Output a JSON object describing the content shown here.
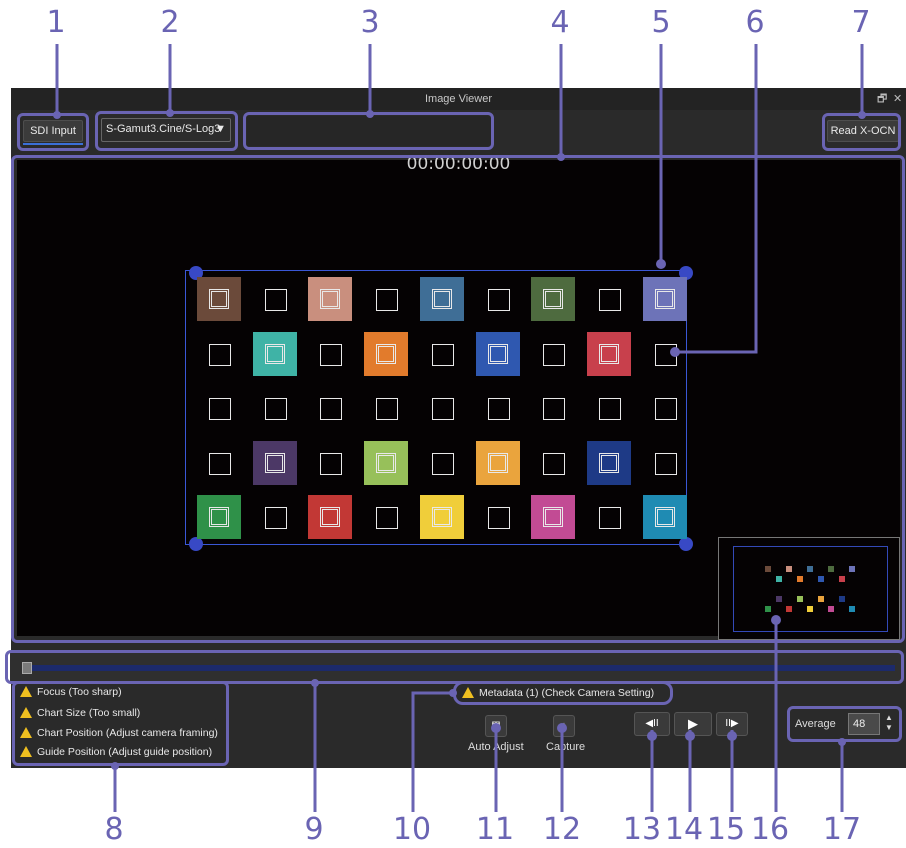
{
  "callouts": [
    "1",
    "2",
    "3",
    "4",
    "5",
    "6",
    "7",
    "8",
    "9",
    "10",
    "11",
    "12",
    "13",
    "14",
    "15",
    "16",
    "17"
  ],
  "window": {
    "title": "Image Viewer",
    "restore_glyph": "🗗",
    "close_glyph": "✕"
  },
  "toolbar": {
    "sdi_input_label": "SDI Input",
    "gamut_select_value": "S-Gamut3.Cine/S-Log3",
    "gamut_arrow": "▼",
    "read_xocn_label": "Read X-OCN"
  },
  "viewer": {
    "timecode": "00:00:00:00"
  },
  "warnings": [
    "Focus (Too sharp)",
    "Chart Size (Too small)",
    "Chart Position (Adjust camera framing)",
    "Guide Position (Adjust guide position)"
  ],
  "metadata_warning": "Metadata (1) (Check Camera Setting)",
  "controls": {
    "auto_adjust_label": "Auto Adjust",
    "capture_label": "Capture",
    "prev_frame_glyph": "◀II",
    "play_glyph": "▶",
    "next_frame_glyph": "II▶"
  },
  "average": {
    "label": "Average",
    "value": "48"
  },
  "colors": {
    "accent": "#6a64b3",
    "guide": "#3a57d6",
    "warning": "#f0c020"
  }
}
